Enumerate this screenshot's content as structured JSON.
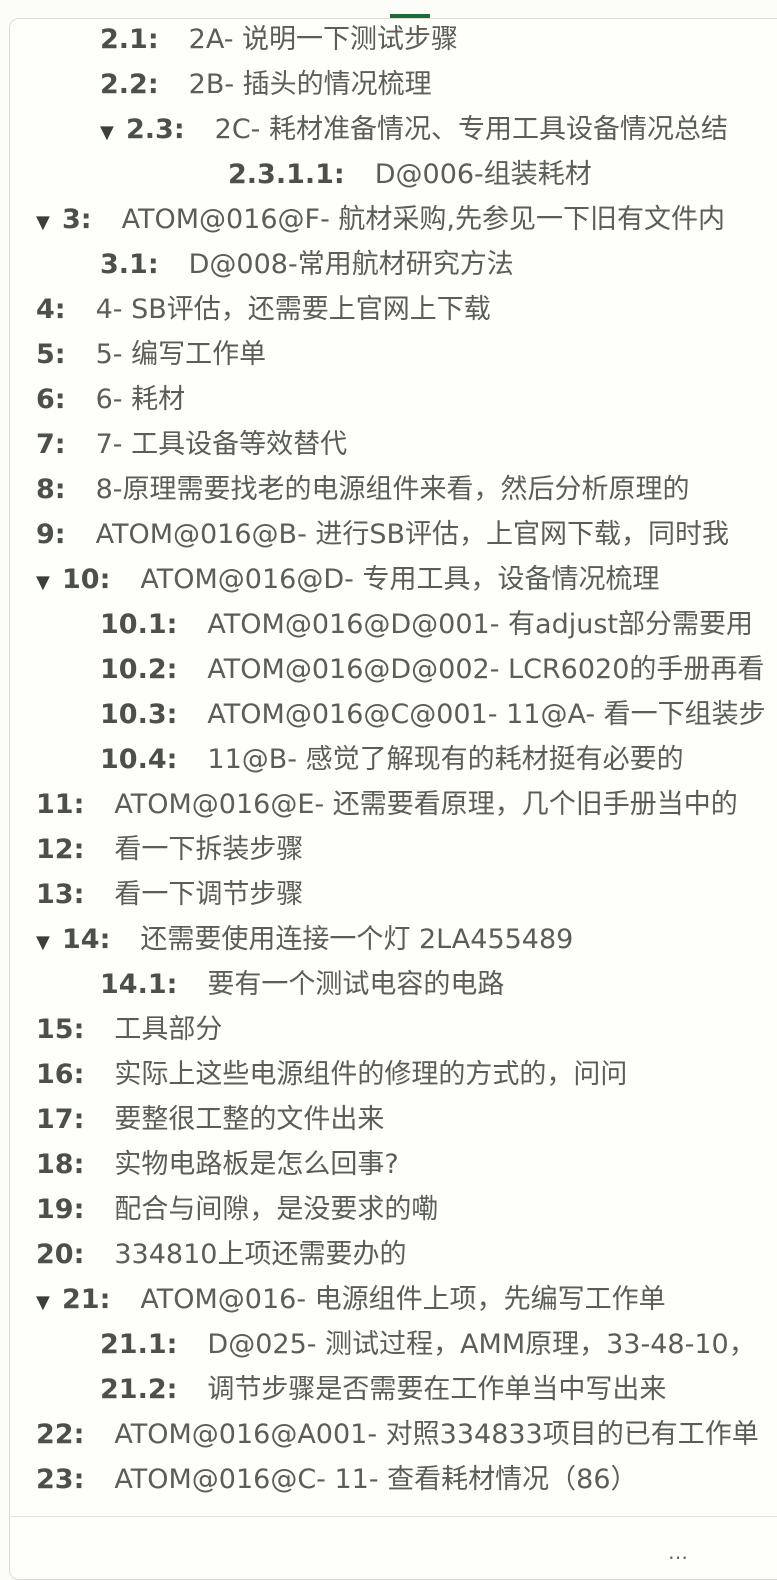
{
  "outline": {
    "items": [
      {
        "number": "2.1:",
        "text": "2A- 说明一下测试步骤",
        "collapsible": false
      },
      {
        "number": "2.2:",
        "text": "2B- 插头的情况梳理",
        "collapsible": false
      },
      {
        "number": "2.3:",
        "text": "2C- 耗材准备情况、专用工具设备情况总结",
        "collapsible": true
      },
      {
        "number": "2.3.1.1:",
        "text": "D@006-组装耗材",
        "collapsible": false
      },
      {
        "number": "3:",
        "text": "ATOM@016@F- 航材采购,先参见一下旧有文件内",
        "collapsible": true
      },
      {
        "number": "3.1:",
        "text": "D@008-常用航材研究方法",
        "collapsible": false
      },
      {
        "number": "4:",
        "text": "4- SB评估，还需要上官网上下载",
        "collapsible": false
      },
      {
        "number": "5:",
        "text": "5- 编写工作单",
        "collapsible": false
      },
      {
        "number": "6:",
        "text": "6- 耗材",
        "collapsible": false
      },
      {
        "number": "7:",
        "text": "7- 工具设备等效替代",
        "collapsible": false
      },
      {
        "number": "8:",
        "text": "8-原理需要找老的电源组件来看，然后分析原理的",
        "collapsible": false
      },
      {
        "number": "9:",
        "text": "ATOM@016@B- 进行SB评估，上官网下载，同时我",
        "collapsible": false
      },
      {
        "number": "10:",
        "text": "ATOM@016@D- 专用工具，设备情况梳理",
        "collapsible": true
      },
      {
        "number": "10.1:",
        "text": "ATOM@016@D@001- 有adjust部分需要用",
        "collapsible": false
      },
      {
        "number": "10.2:",
        "text": "ATOM@016@D@002- LCR6020的手册再看",
        "collapsible": false
      },
      {
        "number": "10.3:",
        "text": "ATOM@016@C@001- 11@A- 看一下组装步",
        "collapsible": false
      },
      {
        "number": "10.4:",
        "text": "11@B- 感觉了解现有的耗材挺有必要的",
        "collapsible": false
      },
      {
        "number": "11:",
        "text": "ATOM@016@E- 还需要看原理，几个旧手册当中的",
        "collapsible": false
      },
      {
        "number": "12:",
        "text": "看一下拆装步骤",
        "collapsible": false
      },
      {
        "number": "13:",
        "text": "看一下调节步骤",
        "collapsible": false
      },
      {
        "number": "14:",
        "text": "还需要使用连接一个灯 2LA455489",
        "collapsible": true
      },
      {
        "number": "14.1:",
        "text": "要有一个测试电容的电路",
        "collapsible": false
      },
      {
        "number": "15:",
        "text": "工具部分",
        "collapsible": false
      },
      {
        "number": "16:",
        "text": "实际上这些电源组件的修理的方式的，问问",
        "collapsible": false
      },
      {
        "number": "17:",
        "text": "要整很工整的文件出来",
        "collapsible": false
      },
      {
        "number": "18:",
        "text": "实物电路板是怎么回事?",
        "collapsible": false
      },
      {
        "number": "19:",
        "text": "配合与间隙，是没要求的嘞",
        "collapsible": false
      },
      {
        "number": "20:",
        "text": "334810上项还需要办的",
        "collapsible": false
      },
      {
        "number": "21:",
        "text": "ATOM@016- 电源组件上项，先编写工作单",
        "collapsible": true
      },
      {
        "number": "21.1:",
        "text": "D@025- 测试过程，AMM原理，33-48-10，",
        "collapsible": false
      },
      {
        "number": "21.2:",
        "text": "调节步骤是否需要在工作单当中写出来",
        "collapsible": false
      },
      {
        "number": "22:",
        "text": "ATOM@016@A001- 对照334833项目的已有工作单",
        "collapsible": false
      },
      {
        "number": "23:",
        "text": "ATOM@016@C- 11- 查看耗材情况（86）",
        "collapsible": false
      }
    ]
  },
  "icons": {
    "collapse": "▼",
    "more": "…"
  }
}
